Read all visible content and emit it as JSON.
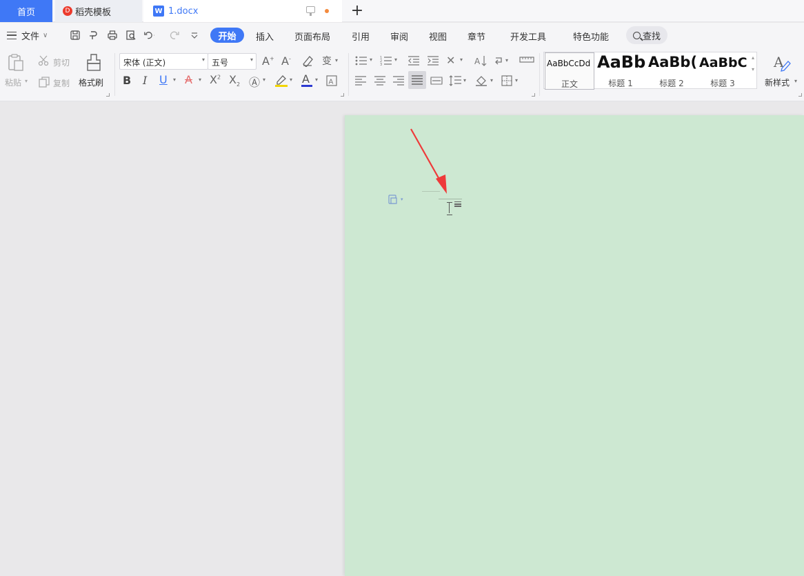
{
  "tabs": {
    "home": "首页",
    "template": "稻壳模板",
    "template_logo": "D",
    "doc": "1.docx",
    "doc_icon": "W",
    "add": "+"
  },
  "menu": {
    "file": "文件",
    "tabs": [
      "开始",
      "插入",
      "页面布局",
      "引用",
      "审阅",
      "视图",
      "章节",
      "开发工具",
      "特色功能"
    ],
    "search": "查找"
  },
  "ribbon": {
    "paste": "粘贴",
    "cut": "剪切",
    "copy": "复制",
    "format_painter": "格式刷",
    "font_name": "宋体 (正文)",
    "font_size": "五号",
    "new_style": "新样式",
    "styles": [
      {
        "sample": "AaBbCcDd",
        "label": "正文"
      },
      {
        "sample": "AaBb",
        "label": "标题 1"
      },
      {
        "sample": "AaBb(",
        "label": "标题 2"
      },
      {
        "sample": "AaBbC(",
        "label": "标题 3"
      }
    ]
  },
  "colors": {
    "accent": "#3f78f6",
    "page_bg": "#cde8d2",
    "workspace_bg": "#e9e8ea",
    "annotation_arrow": "#ee3a3a"
  }
}
